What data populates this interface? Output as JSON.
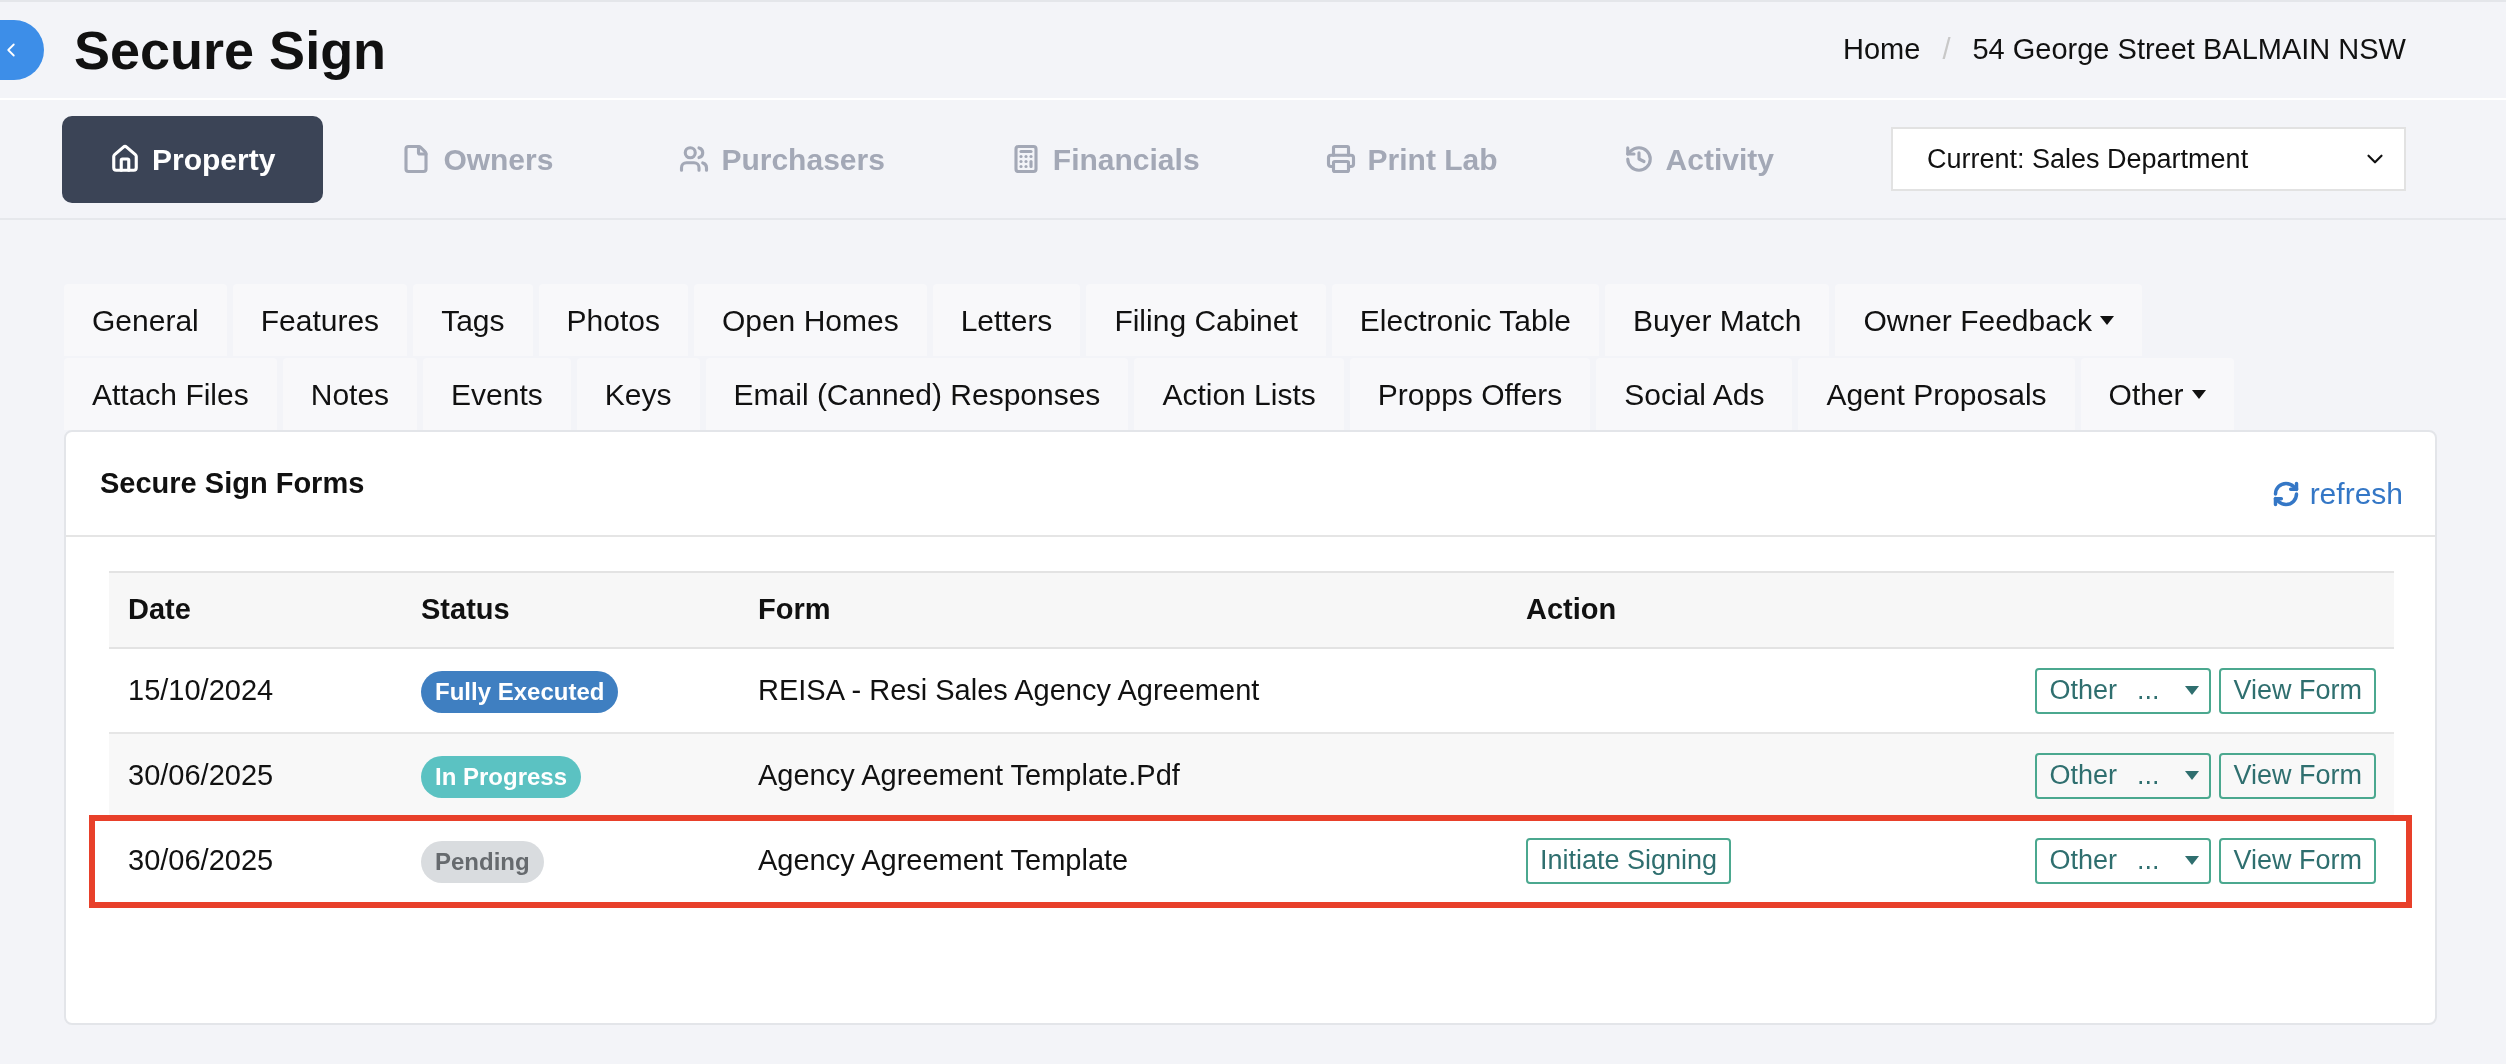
{
  "header": {
    "title": "Secure Sign",
    "breadcrumb": [
      "Home",
      "54 George Street BALMAIN NSW"
    ],
    "separator": "/"
  },
  "nav": [
    {
      "label": "Property",
      "selected": true
    },
    {
      "label": "Owners",
      "selected": false
    },
    {
      "label": "Purchasers",
      "selected": false
    },
    {
      "label": "Financials",
      "selected": false
    },
    {
      "label": "Print Lab",
      "selected": false
    },
    {
      "label": "Activity",
      "selected": false
    }
  ],
  "department_select": {
    "value": "Current: Sales Department"
  },
  "tab_rows": [
    [
      {
        "label": "General",
        "menu": false
      },
      {
        "label": "Features",
        "menu": false
      },
      {
        "label": "Tags",
        "menu": false
      },
      {
        "label": "Photos",
        "menu": false
      },
      {
        "label": "Open Homes",
        "menu": false
      },
      {
        "label": "Letters",
        "menu": false
      },
      {
        "label": "Filing Cabinet",
        "menu": false
      },
      {
        "label": "Electronic Table",
        "menu": false
      },
      {
        "label": "Buyer Match",
        "menu": false
      },
      {
        "label": "Owner Feedback",
        "menu": true
      }
    ],
    [
      {
        "label": "Attach Files",
        "menu": false
      },
      {
        "label": "Notes",
        "menu": false
      },
      {
        "label": "Events",
        "menu": false
      },
      {
        "label": "Keys",
        "menu": false
      },
      {
        "label": "Email (Canned) Responses",
        "menu": false
      },
      {
        "label": "Action Lists",
        "menu": false
      },
      {
        "label": "Propps Offers",
        "menu": false
      },
      {
        "label": "Social Ads",
        "menu": false
      },
      {
        "label": "Agent Proposals",
        "menu": false
      },
      {
        "label": "Other",
        "menu": true
      }
    ]
  ],
  "panel": {
    "title": "Secure Sign Forms",
    "refresh": "refresh",
    "table": {
      "columns": [
        "Date",
        "Status",
        "Form",
        "Action"
      ],
      "rows": [
        {
          "date": "15/10/2024",
          "status": {
            "label": "Fully Executed",
            "kind": "executed"
          },
          "form": "REISA - Resi Sales Agency Agreement",
          "action": null,
          "other": "Other",
          "other_ellipsis": "...",
          "view": "View Form",
          "highlighted": false
        },
        {
          "date": "30/06/2025",
          "status": {
            "label": "In Progress",
            "kind": "progress"
          },
          "form": "Agency Agreement Template.Pdf",
          "action": null,
          "other": "Other",
          "other_ellipsis": "...",
          "view": "View Form",
          "highlighted": false
        },
        {
          "date": "30/06/2025",
          "status": {
            "label": "Pending",
            "kind": "pending"
          },
          "form": "Agency Agreement Template",
          "action": "Initiate Signing",
          "other": "Other",
          "other_ellipsis": "...",
          "view": "View Form",
          "highlighted": true
        }
      ]
    }
  }
}
